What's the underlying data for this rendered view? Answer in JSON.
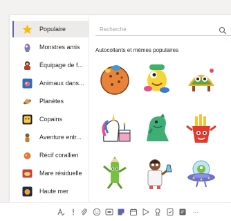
{
  "sidebar": {
    "items": [
      {
        "label": "Populaire",
        "icon": "star-icon",
        "active": true
      },
      {
        "label": "Monstres amis",
        "icon": "monster-icon"
      },
      {
        "label": "Équipage de f...",
        "icon": "crew-icon"
      },
      {
        "label": "Animaux dans...",
        "icon": "animal-icon"
      },
      {
        "label": "Planètes",
        "icon": "planet-icon"
      },
      {
        "label": "Copains",
        "icon": "buddy-icon"
      },
      {
        "label": "Aventure entr...",
        "icon": "adventure-icon"
      },
      {
        "label": "Récif corallien",
        "icon": "coral-icon"
      },
      {
        "label": "Mare résiduelle",
        "icon": "tidepool-icon"
      },
      {
        "label": "Haute mer",
        "icon": "deep-sea-icon"
      }
    ]
  },
  "search": {
    "placeholder": "Recherche",
    "icon": "search-icon"
  },
  "section": {
    "title": "Autocollants et mèmes populaires"
  },
  "stickers": [
    "melon-ball-sticker",
    "yellow-monster-sticker",
    "taco-monster-sticker",
    "unicorn-cake-sticker",
    "green-dinosaur-sticker",
    "fries-monster-sticker",
    "crayon-sticker",
    "scientist-sticker",
    "ufo-alien-sticker"
  ],
  "toolbar": {
    "icons": [
      "format-icon",
      "important-icon",
      "attach-icon",
      "emoji-icon",
      "gif-icon",
      "sticker-icon",
      "schedule-meeting-icon",
      "stream-icon",
      "praise-icon",
      "approvals-icon",
      "forms-icon",
      "more-icon"
    ],
    "more_label": "···"
  },
  "colors": {
    "accent": "#6264a7",
    "active_bg": "#edebe9",
    "star": "#ffb900"
  }
}
